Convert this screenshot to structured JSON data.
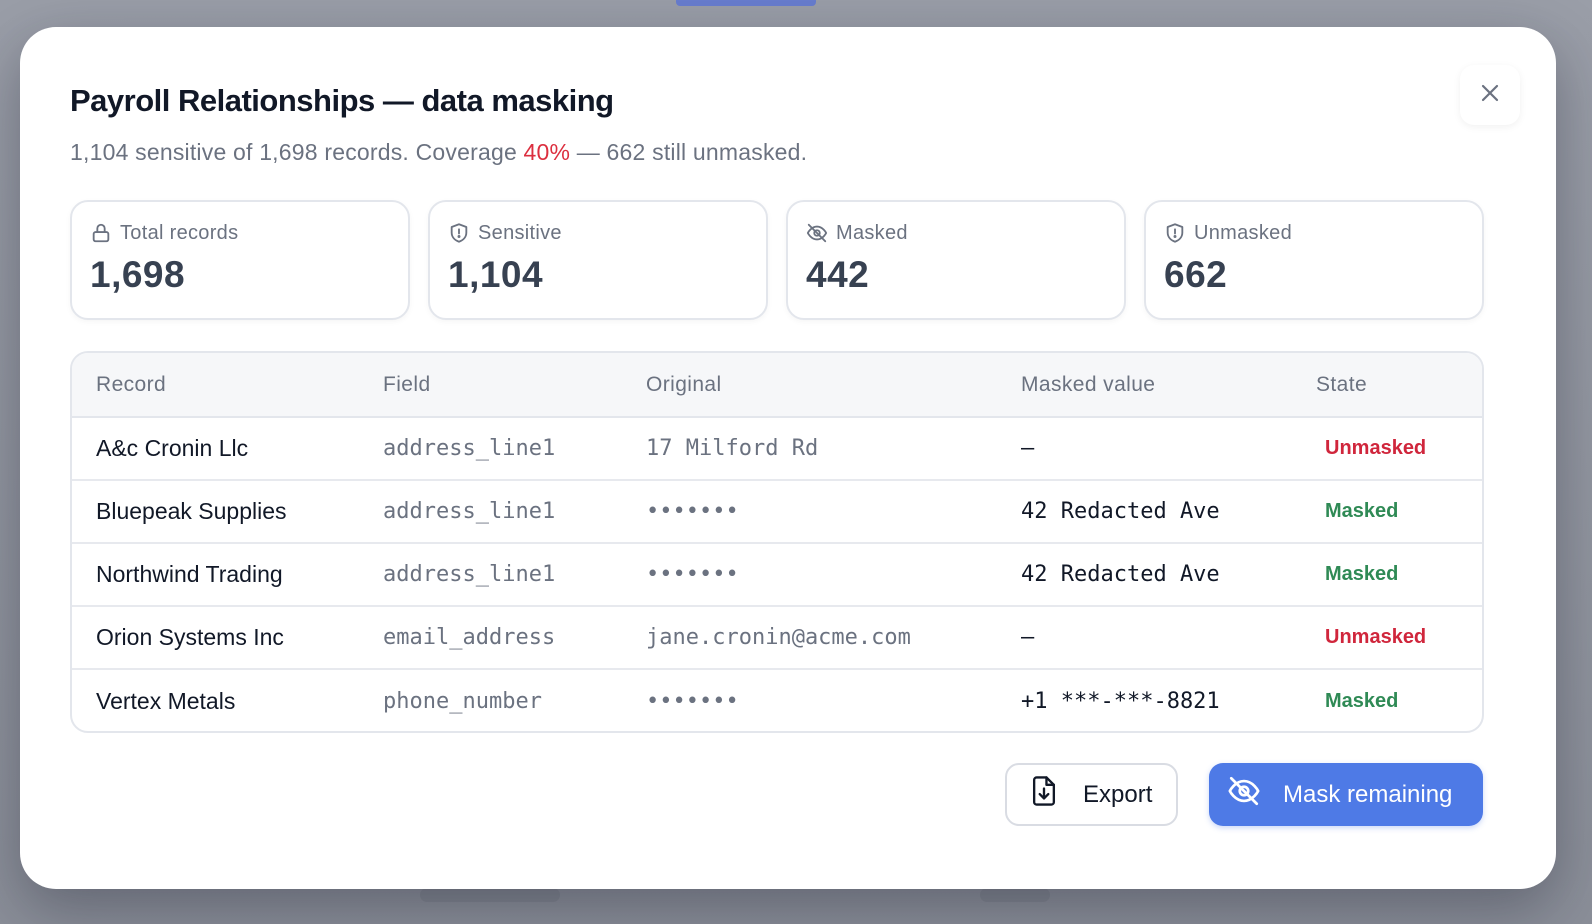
{
  "dialog": {
    "title": "Payroll Relationships — data masking",
    "subtitle_prefix": "1,104 sensitive of 1,698 records. Coverage ",
    "subtitle_coverage": "40%",
    "subtitle_suffix": " — 662 still unmasked."
  },
  "stats": [
    {
      "label": "Total records",
      "value": "1,698",
      "icon": "lock-icon"
    },
    {
      "label": "Sensitive",
      "value": "1,104",
      "icon": "shield-alert-icon"
    },
    {
      "label": "Masked",
      "value": "442",
      "icon": "eye-off-icon"
    },
    {
      "label": "Unmasked",
      "value": "662",
      "icon": "shield-alert-icon"
    }
  ],
  "table": {
    "headers": [
      "Record",
      "Field",
      "Original",
      "Masked value",
      "State"
    ],
    "rows": [
      {
        "record": "A&c Cronin Llc",
        "field": "address_line1",
        "original": "17 Milford Rd",
        "masked": "—",
        "state": "Unmasked"
      },
      {
        "record": "Bluepeak Supplies",
        "field": "address_line1",
        "original": "•••••••",
        "masked": "42 Redacted Ave",
        "state": "Masked"
      },
      {
        "record": "Northwind Trading",
        "field": "address_line1",
        "original": "•••••••",
        "masked": "42 Redacted Ave",
        "state": "Masked"
      },
      {
        "record": "Orion Systems Inc",
        "field": "email_address",
        "original": "jane.cronin@acme.com",
        "masked": "—",
        "state": "Unmasked"
      },
      {
        "record": "Vertex Metals",
        "field": "phone_number",
        "original": "•••••••",
        "masked": "+1 ***-***-8821",
        "state": "Masked"
      }
    ]
  },
  "actions": {
    "export_label": "Export",
    "mask_label": "Mask remaining"
  },
  "colors": {
    "accent": "#4e7ae6",
    "danger": "#d0263c",
    "success": "#2f8a55"
  }
}
